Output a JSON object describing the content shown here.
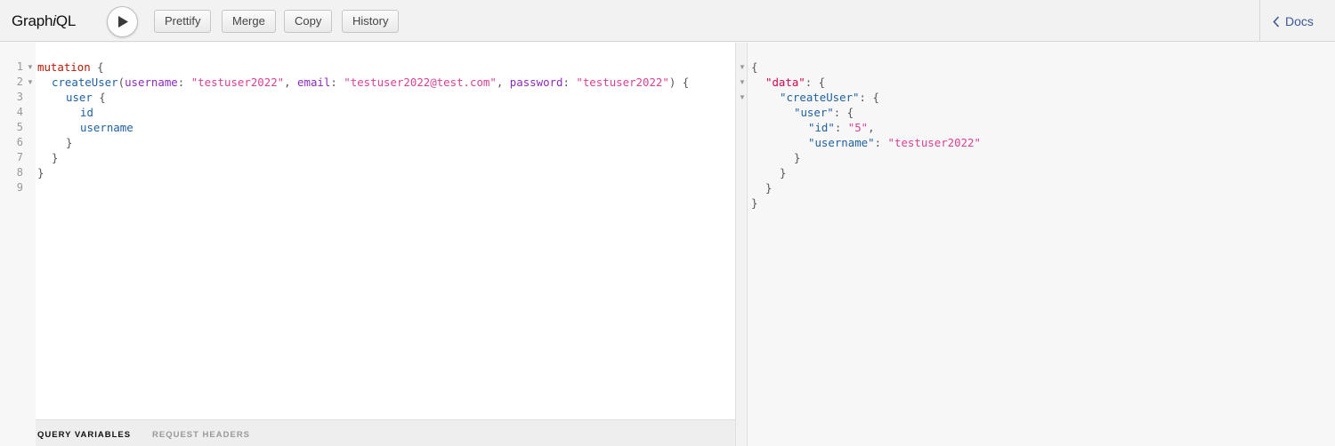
{
  "app": {
    "title_prefix": "Graph",
    "title_italic": "i",
    "title_suffix": "QL"
  },
  "toolbar": {
    "run_label": "Execute Query",
    "buttons": [
      "Prettify",
      "Merge",
      "Copy",
      "History"
    ],
    "docs_label": "Docs"
  },
  "editor": {
    "line_numbers": [
      "1",
      "2",
      "3",
      "4",
      "5",
      "6",
      "7",
      "8",
      "9"
    ],
    "line1": {
      "keyword": "mutation",
      "brace": " {"
    },
    "line2": {
      "field": "createUser",
      "open": "(",
      "arg1": "username",
      "colon1": ": ",
      "val1": "\"testuser2022\"",
      "sep1": ", ",
      "arg2": "email",
      "colon2": ": ",
      "val2": "\"testuser2022@test.com\"",
      "sep2": ", ",
      "arg3": "password",
      "colon3": ": ",
      "val3": "\"testuser2022\"",
      "close": ") {"
    },
    "line3": {
      "field": "user",
      "brace": " {"
    },
    "line4": {
      "field": "id"
    },
    "line5": {
      "field": "username"
    },
    "line6": {
      "brace": "}"
    },
    "line7": {
      "brace": "}"
    },
    "line8": {
      "brace": "}"
    }
  },
  "bottom_tabs": {
    "query_variables": "QUERY VARIABLES",
    "request_headers": "REQUEST HEADERS"
  },
  "result": {
    "open": "{",
    "data_key": "\"data\"",
    "create_user_key": "\"createUser\"",
    "user_key": "\"user\"",
    "id_key": "\"id\"",
    "id_value": "\"5\"",
    "username_key": "\"username\"",
    "username_value": "\"testuser2022\"",
    "colon_brace": ": {",
    "colon": ": ",
    "comma": ",",
    "close": "}"
  },
  "colors": {
    "keyword": "#b11a04",
    "field": "#1f61a0",
    "argument": "#8b2bb9",
    "string": "#d64292",
    "docs_link": "#3b5998"
  }
}
